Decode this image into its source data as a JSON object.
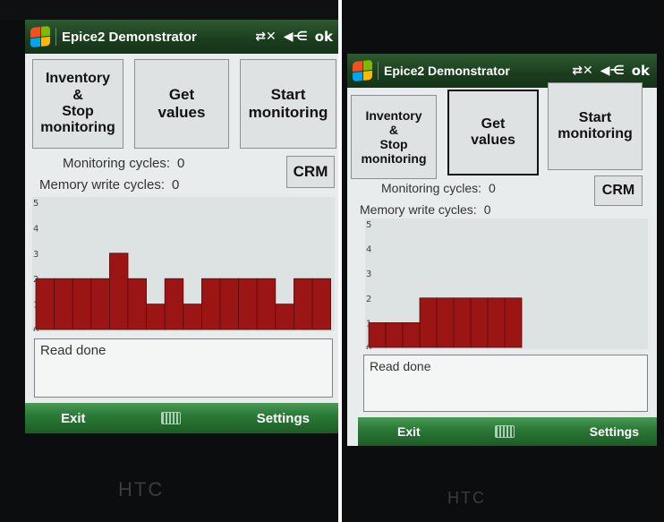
{
  "app_title": "Epice2 Demonstrator",
  "ok_label": "ok",
  "icons": {
    "connection": "connectivity-icon",
    "volume": "volume-icon",
    "start": "windows-start-icon",
    "keyboard": "keyboard-icon"
  },
  "buttons": {
    "inventory": "Inventory\n&\nStop\nmonitoring",
    "get_values": "Get\nvalues",
    "start_monitoring": "Start\nmonitoring",
    "crm": "CRM"
  },
  "monitoring_label": "Monitoring cycles:",
  "monitoring_value": "0",
  "memory_label": "Memory write cycles:",
  "memory_value": "0",
  "log_text": "Read done",
  "softkeys": {
    "left": "Exit",
    "right": "Settings"
  },
  "device_brand": "HTC",
  "colors": {
    "bar": "#9b1515",
    "titlebar": "#1b3d1e",
    "softkey": "#2b7a38"
  },
  "chart_data": [
    {
      "type": "bar",
      "ylim": [
        0,
        5
      ],
      "yticks": [
        "0",
        "1",
        "2",
        "3",
        "4",
        "5"
      ],
      "values": [
        2,
        2,
        2,
        2,
        3,
        2,
        1,
        2,
        1,
        2,
        2,
        2,
        2,
        1,
        2,
        2
      ]
    },
    {
      "type": "bar",
      "ylim": [
        0,
        5
      ],
      "yticks": [
        "0",
        "1",
        "2",
        "3",
        "4",
        "5"
      ],
      "values": [
        1,
        1,
        1,
        2,
        2,
        2,
        2,
        2,
        2
      ]
    }
  ]
}
